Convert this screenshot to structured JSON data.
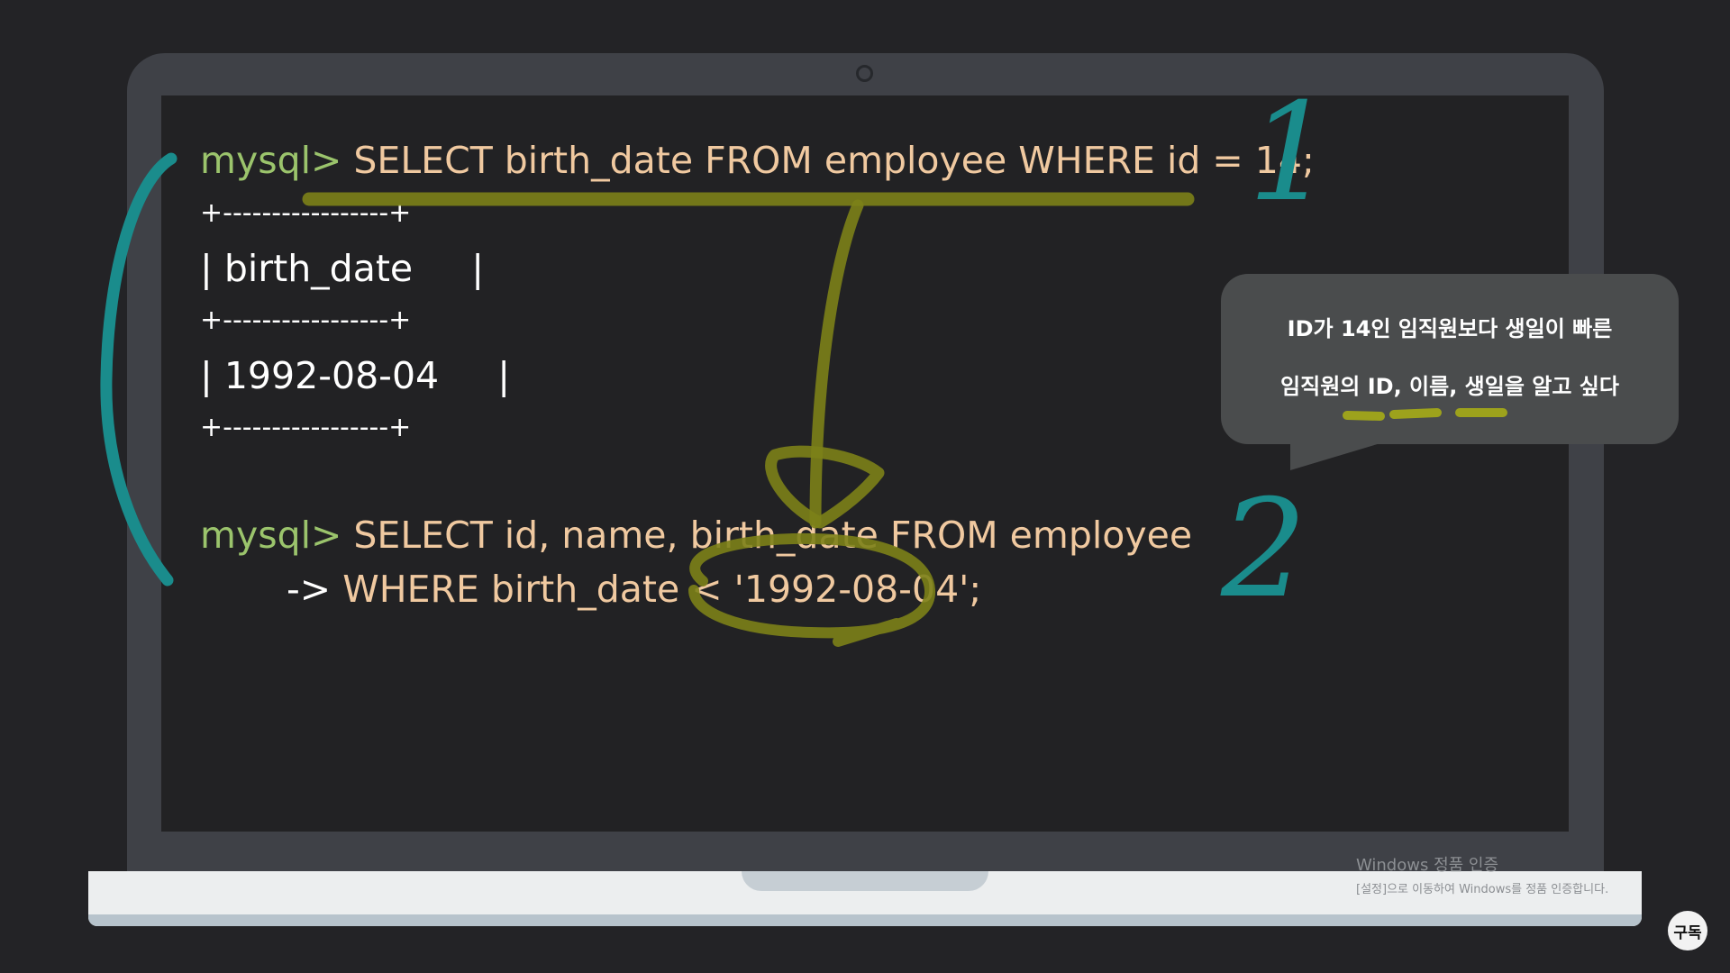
{
  "terminal": {
    "query1": {
      "prompt": "mysql>",
      "command": "SELECT birth_date FROM employee WHERE id = 14;"
    },
    "result": {
      "border": "+-----------------+",
      "header_row": "| birth_date     |",
      "value_row": "| 1992-08-04     |"
    },
    "query2": {
      "prompt": "mysql>",
      "command_line1": "SELECT id, name, birth_date FROM employee",
      "continuation": "->",
      "command_line2": "WHERE birth_date < '1992-08-04';"
    }
  },
  "annotations": {
    "number1": "1",
    "number2": "2"
  },
  "speech_bubble": {
    "line1": "ID가 14인 임직원보다 생일이 빠른",
    "line2": "임직원의 ID, 이름, 생일을 알고 싶다"
  },
  "watermark": {
    "title": "Windows 정품 인증",
    "subtitle": "[설정]으로 이동하여 Windows를 정품 인증합니다."
  },
  "subscribe_button": {
    "label": "구독"
  },
  "colors": {
    "background": "#232326",
    "screen": "#222224",
    "prompt": "#9bc46c",
    "command": "#f0c9a0",
    "teal_marker": "#1a8c8c",
    "olive_marker": "#8a8f1e"
  }
}
